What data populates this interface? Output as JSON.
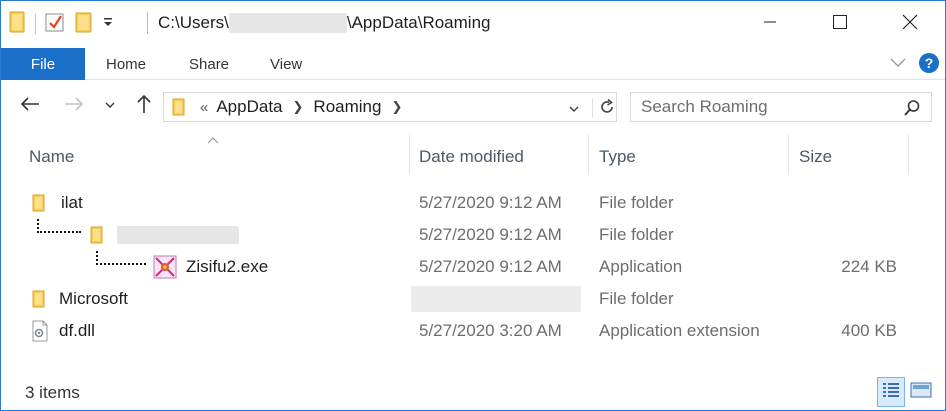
{
  "window": {
    "title_prefix": "C:\\Users\\",
    "title_suffix": "\\AppData\\Roaming",
    "accent": "#1a6fc9",
    "controls": {
      "minimize": "minimize-icon",
      "maximize": "maximize-icon",
      "close": "close-icon"
    }
  },
  "ribbon": {
    "tabs": [
      "File",
      "Home",
      "Share",
      "View"
    ],
    "help_label": "?"
  },
  "nav": {
    "overflow": "«",
    "breadcrumbs": [
      "AppData",
      "Roaming"
    ],
    "search_placeholder": "Search Roaming"
  },
  "columns": [
    "Name",
    "Date modified",
    "Type",
    "Size"
  ],
  "rows": [
    {
      "name": "ilat",
      "date": "5/27/2020 9:12 AM",
      "type": "File folder",
      "size": "",
      "icon": "folder-icon",
      "indent": 0
    },
    {
      "name": "",
      "date": "5/27/2020 9:12 AM",
      "type": "File folder",
      "size": "",
      "icon": "folder-icon",
      "indent": 1
    },
    {
      "name": "Zisifu2.exe",
      "date": "5/27/2020 9:12 AM",
      "type": "Application",
      "size": "224 KB",
      "icon": "executable-icon",
      "indent": 2
    },
    {
      "name": "Microsoft",
      "date": "",
      "type": "File folder",
      "size": "",
      "icon": "folder-icon",
      "indent": 0
    },
    {
      "name": "df.dll",
      "date": "5/27/2020 3:20 AM",
      "type": "Application extension",
      "size": "400 KB",
      "icon": "dll-file-icon",
      "indent": 0
    }
  ],
  "status": {
    "item_count": "3 items",
    "view_modes": [
      "details-view-icon",
      "large-icons-view-icon"
    ]
  }
}
